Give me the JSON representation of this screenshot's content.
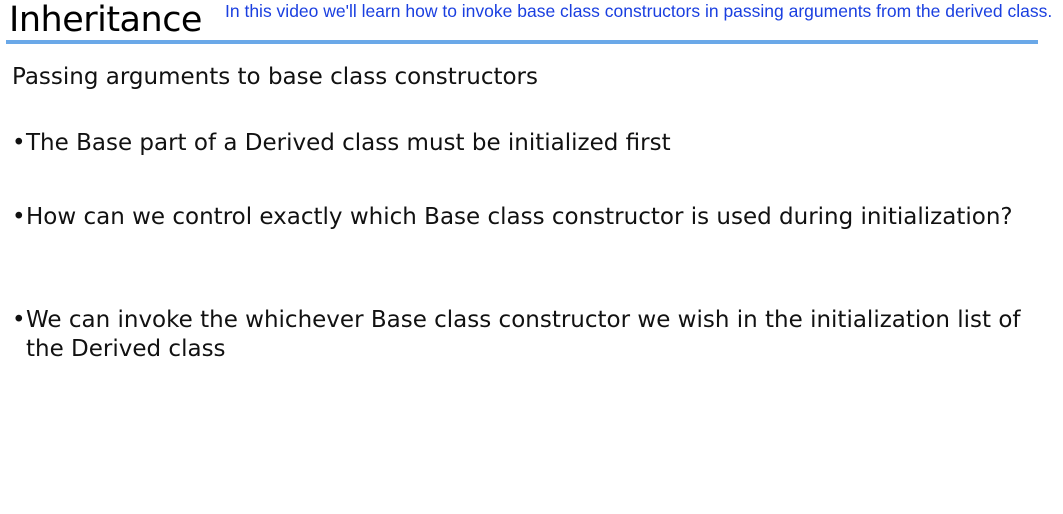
{
  "slide": {
    "title": "Inheritance",
    "overlay_caption": "In this video we'll learn how to invoke base class constructors in passing arguments from the derived class.",
    "subtitle": "Passing arguments to base class constructors",
    "bullet_glyph": "•",
    "bullets": [
      "The Base part of a Derived class must be initialized first",
      "How can we control exactly which Base class constructor is used during initialization?",
      "We can invoke the whichever Base class constructor we wish in the initialization list of the Derived class"
    ]
  },
  "colors": {
    "title_rule": "#6aa8e8",
    "caption_text": "#1a3fe0",
    "body_text": "#111111"
  }
}
